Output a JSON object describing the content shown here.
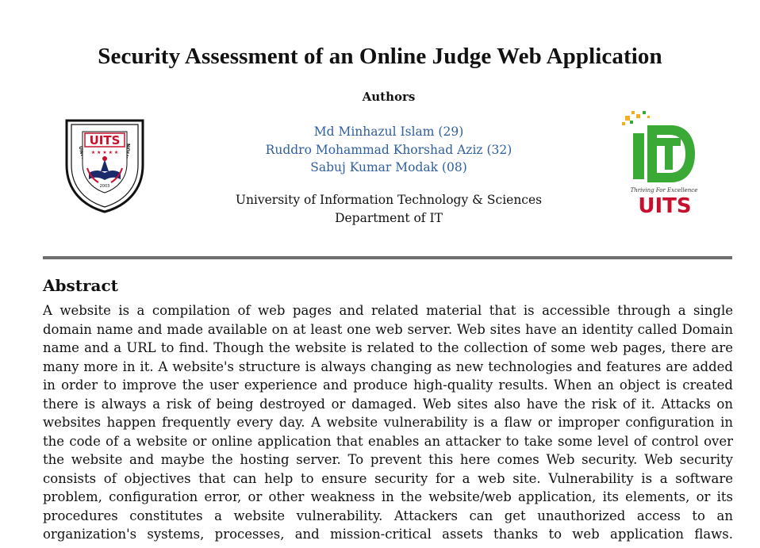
{
  "paper": {
    "title": "Security Assessment of an Online Judge Web Application",
    "authors_heading": "Authors",
    "authors": [
      "Md Minhazul Islam (29)",
      "Ruddro Mohammad Khorshad Aziz (32)",
      "Sabuj Kumar Modak (08)"
    ],
    "affiliation": [
      "University of Information Technology & Sciences",
      "Department of IT"
    ]
  },
  "logos": {
    "left": {
      "text": "UITS",
      "ring_text": "UNIVERSITY OF INFORMATION TECHNOLOGY AND SCIENCES",
      "year": "2003",
      "color_primary": "#c8102e",
      "color_secondary": "#1b2a6b"
    },
    "right": {
      "mark": "ID",
      "tagline": "Thriving For Excellence",
      "text": "UITS",
      "color_green": "#3aa935",
      "color_red": "#c8102e",
      "color_dots": "#f2b01e"
    }
  },
  "abstract": {
    "heading": "Abstract",
    "lines": [
      "A website is a compilation of web pages and related material that is accessible through a single",
      "domain name and made available on at least one web server. Web sites have an identity called Domain",
      "name and a URL to find. Though the website is related to the collection of some web pages, there are",
      "many more in it. A website's structure is always changing as new technologies and features are added",
      "in order to improve the user experience and produce high-quality results. When an object is created",
      "there is always a risk of being destroyed or damaged. Web sites also have the risk of it. Attacks on",
      "websites happen frequently every day. A website vulnerability is a flaw or improper configuration in",
      "the code of a website or online application that enables an attacker to take some level of control over",
      "the website and maybe the hosting server. To prevent this here comes Web security. Web security",
      "consists of objectives that can help to ensure security for a web site. Vulnerability is a software",
      "problem, configuration error, or other weakness in the website/web application, its elements, or its",
      "procedures constitutes a website vulnerability. Attackers can get unauthorized access to an",
      "organization's systems, processes, and mission-critical assets thanks to web application flaws."
    ]
  }
}
